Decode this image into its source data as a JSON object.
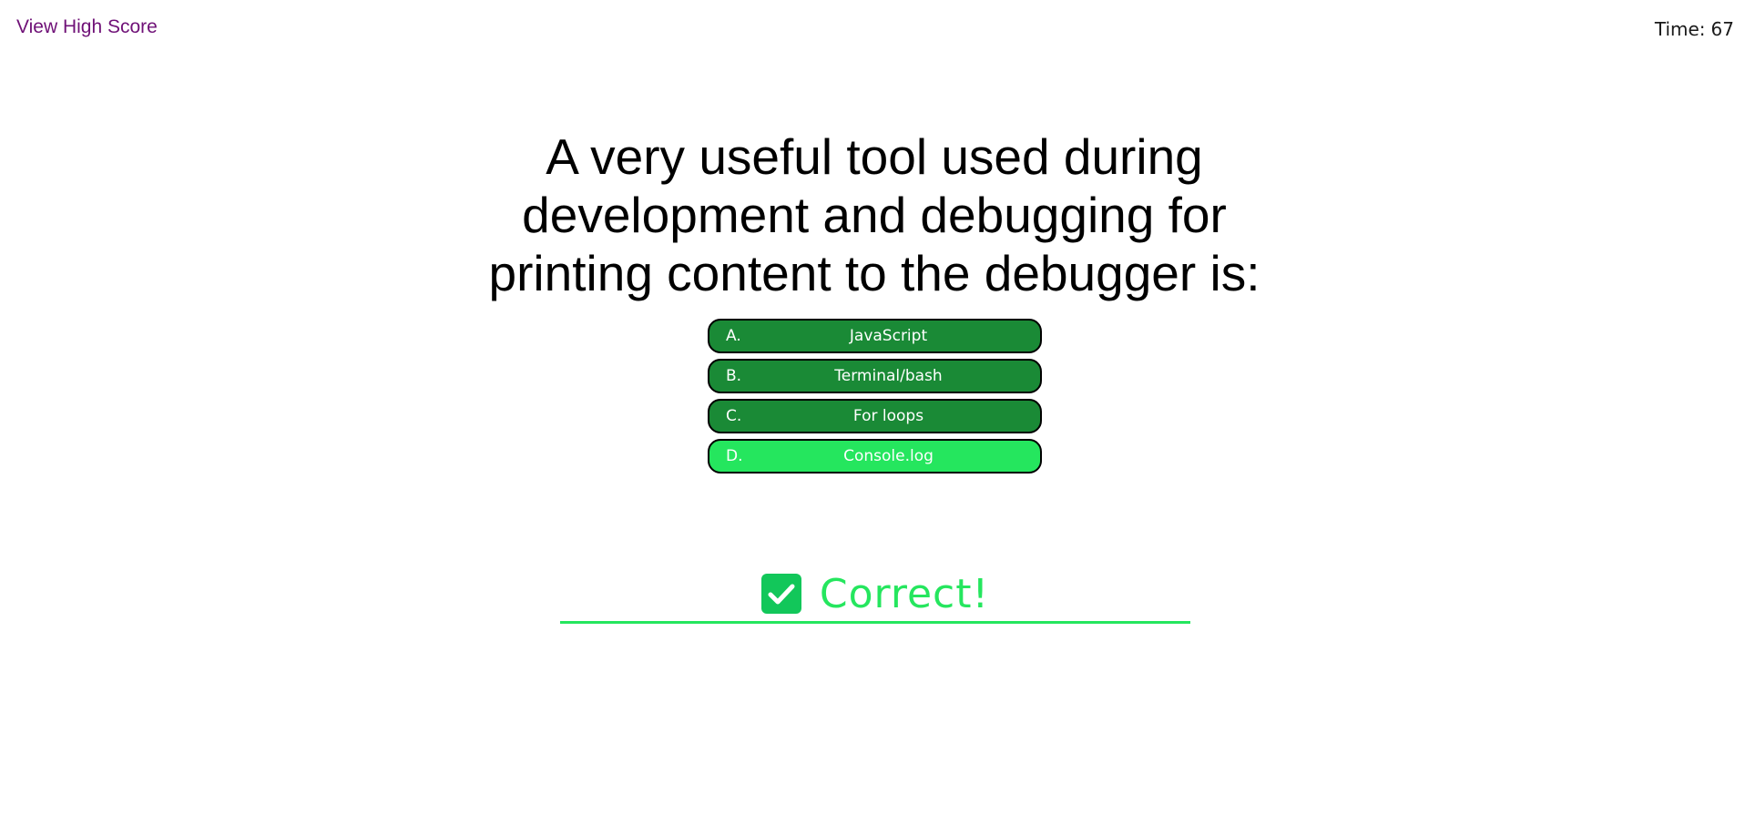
{
  "header": {
    "high_score_label": "View High Score",
    "timer_label": "Time:",
    "timer_value": "67"
  },
  "quiz": {
    "question": "A very useful tool used during development and debugging for printing content to the debugger is:",
    "answers": [
      {
        "letter": "A.",
        "text": "JavaScript",
        "selected": false
      },
      {
        "letter": "B.",
        "text": "Terminal/bash",
        "selected": false
      },
      {
        "letter": "C.",
        "text": "For loops",
        "selected": false
      },
      {
        "letter": "D.",
        "text": "Console.log",
        "selected": true
      }
    ]
  },
  "feedback": {
    "icon": "check-square-icon",
    "text": "Correct!",
    "color": "#25e65e"
  },
  "colors": {
    "answer_bg": "#1a8a36",
    "answer_selected_bg": "#25e65e",
    "link": "#6f1177"
  }
}
